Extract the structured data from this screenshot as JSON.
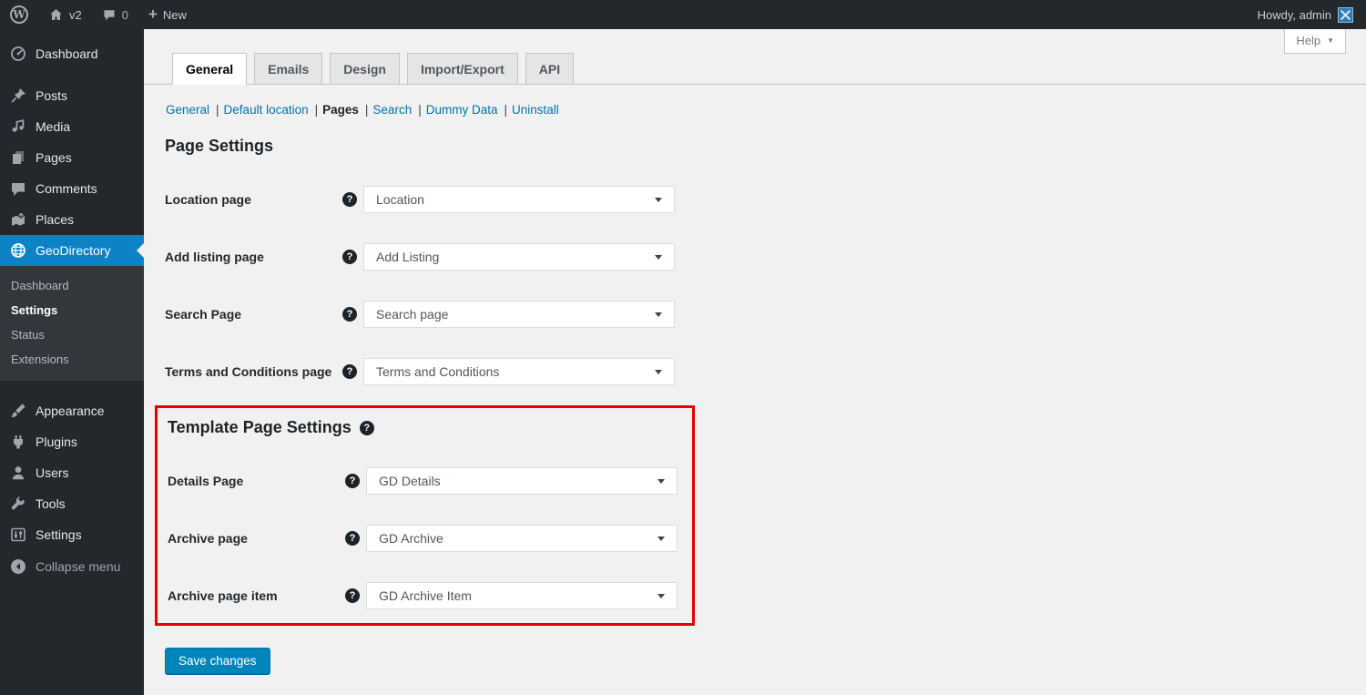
{
  "glyphs": {
    "wp": "W",
    "question": "?",
    "caret_down": "▼"
  },
  "admin_bar": {
    "site": "v2",
    "comments_count": "0",
    "new_label": "New",
    "howdy": "Howdy, admin"
  },
  "help": {
    "label": "Help"
  },
  "sidebar": {
    "items": [
      {
        "label": "Dashboard",
        "icon": "dashboard-icon"
      },
      {
        "label": "Posts",
        "icon": "pushpin-icon"
      },
      {
        "label": "Media",
        "icon": "media-icon"
      },
      {
        "label": "Pages",
        "icon": "pages-icon"
      },
      {
        "label": "Comments",
        "icon": "comment-icon"
      },
      {
        "label": "Places",
        "icon": "map-pin-icon"
      },
      {
        "label": "GeoDirectory",
        "icon": "globe-icon",
        "active": true
      }
    ],
    "submenu": [
      {
        "label": "Dashboard"
      },
      {
        "label": "Settings",
        "current": true
      },
      {
        "label": "Status"
      },
      {
        "label": "Extensions"
      }
    ],
    "lower": [
      {
        "label": "Appearance",
        "icon": "brush-icon"
      },
      {
        "label": "Plugins",
        "icon": "plug-icon"
      },
      {
        "label": "Users",
        "icon": "user-icon"
      },
      {
        "label": "Tools",
        "icon": "wrench-icon"
      },
      {
        "label": "Settings",
        "icon": "sliders-icon"
      }
    ],
    "collapse": "Collapse menu"
  },
  "tabs": [
    {
      "label": "General",
      "active": true
    },
    {
      "label": "Emails"
    },
    {
      "label": "Design"
    },
    {
      "label": "Import/Export"
    },
    {
      "label": "API"
    }
  ],
  "subnav": {
    "separator": "|",
    "items": [
      {
        "label": "General"
      },
      {
        "label": "Default location"
      },
      {
        "label": "Pages",
        "current": true
      },
      {
        "label": "Search"
      },
      {
        "label": "Dummy Data"
      },
      {
        "label": "Uninstall"
      }
    ]
  },
  "settings": {
    "heading": "Page Settings",
    "rows": [
      {
        "label": "Location page",
        "value": "Location"
      },
      {
        "label": "Add listing page",
        "value": "Add Listing"
      },
      {
        "label": "Search Page",
        "value": "Search page"
      },
      {
        "label": "Terms and Conditions page",
        "value": "Terms and Conditions"
      }
    ],
    "template": {
      "heading": "Template Page Settings",
      "rows": [
        {
          "label": "Details Page",
          "value": "GD Details"
        },
        {
          "label": "Archive page",
          "value": "GD Archive"
        },
        {
          "label": "Archive page item",
          "value": "GD Archive Item"
        }
      ]
    },
    "save_label": "Save changes"
  },
  "colors": {
    "admin_dark": "#23282d",
    "submenu_dark": "#32373c",
    "menu_active_blue": "#0d82c4",
    "button_blue": "#0085ba",
    "link_blue": "#0073aa",
    "highlight_red": "#e60000",
    "content_bg": "#f1f1f1"
  }
}
